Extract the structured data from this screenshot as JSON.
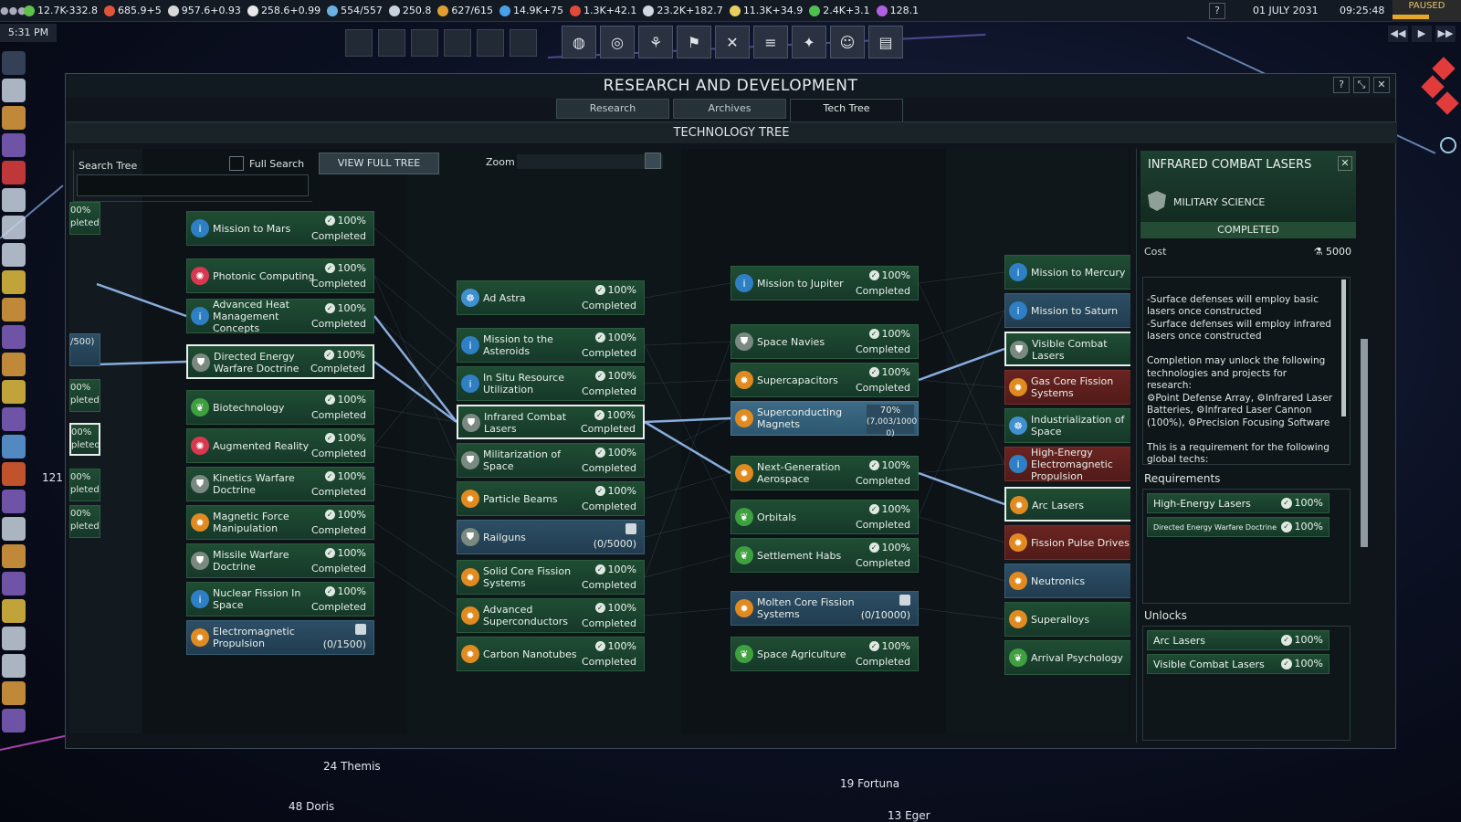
{
  "topbar": {
    "resources": [
      {
        "icon": "leaf-icon",
        "color": "#5fc24a",
        "text": "12.7K-332.8"
      },
      {
        "icon": "burst-icon",
        "color": "#e0553a",
        "text": "685.9+5"
      },
      {
        "icon": "swords-icon",
        "color": "#d8d8d8",
        "text": "957.6+0.93"
      },
      {
        "icon": "rocket-icon",
        "color": "#e8e8e8",
        "text": "258.6+0.99"
      },
      {
        "icon": "satellite-icon",
        "color": "#6ab0e0",
        "text": "554/557"
      },
      {
        "icon": "flask-icon",
        "color": "#c8d2e0",
        "text": "250.8"
      },
      {
        "icon": "coin-icon",
        "color": "#e0a030",
        "text": "627/615"
      },
      {
        "icon": "water-icon",
        "color": "#4aa0e8",
        "text": "14.9K+75"
      },
      {
        "icon": "fuel-icon",
        "color": "#e04a3a",
        "text": "1.3K+42.1"
      },
      {
        "icon": "metal-icon",
        "color": "#d0d8e0",
        "text": "23.2K+182.7"
      },
      {
        "icon": "noble-metal-icon",
        "color": "#e8d060",
        "text": "11.3K+34.9"
      },
      {
        "icon": "fissile-icon",
        "color": "#50c050",
        "text": "2.4K+3.1"
      },
      {
        "icon": "exotic-icon",
        "color": "#b060e0",
        "text": "128.1"
      }
    ],
    "help": "?",
    "date": "01 JULY 2031",
    "time": "09:25:48",
    "paused": "PAUSED",
    "clock": "5:31 PM",
    "speed_controls": [
      "◀◀",
      "▶",
      "▶▶"
    ]
  },
  "window": {
    "title": "RESEARCH AND DEVELOPMENT",
    "controls": [
      "?",
      "⤡",
      "✕"
    ],
    "tabs": [
      {
        "label": "Research",
        "active": false
      },
      {
        "label": "Archives",
        "active": false
      },
      {
        "label": "Tech Tree",
        "active": true
      }
    ],
    "subtitle": "TECHNOLOGY TREE"
  },
  "tree_controls": {
    "search_label": "Search Tree",
    "search_value": "",
    "full_search_label": "Full Search",
    "view_full_tree": "VIEW FULL TREE",
    "zoom_label": "Zoom"
  },
  "edge_nodes": [
    {
      "line1": "00%",
      "line2": "pleted"
    },
    {
      "line1": "",
      "line2": "/500)"
    },
    {
      "line1": "00%",
      "line2": "pleted"
    },
    {
      "line1": "00%",
      "line2": "pleted"
    },
    {
      "line1": "00%",
      "line2": "pleted"
    },
    {
      "line1": "00%",
      "line2": "pleted"
    }
  ],
  "col1": [
    {
      "name": "Mission to Mars",
      "pct": "100%",
      "status": "Completed",
      "icon": "info-icon",
      "style": "green"
    },
    {
      "name": "Photonic Computing",
      "pct": "100%",
      "status": "Completed",
      "icon": "virus-icon",
      "style": "green"
    },
    {
      "name": "Advanced Heat Management Concepts",
      "pct": "100%",
      "status": "Completed",
      "icon": "info-icon",
      "style": "green"
    },
    {
      "name": "Directed Energy Warfare Doctrine",
      "pct": "100%",
      "status": "Completed",
      "icon": "shield-icon",
      "style": "sel"
    },
    {
      "name": "Biotechnology",
      "pct": "100%",
      "status": "Completed",
      "icon": "sprout-icon",
      "style": "green"
    },
    {
      "name": "Augmented Reality",
      "pct": "100%",
      "status": "Completed",
      "icon": "virus-icon",
      "style": "green"
    },
    {
      "name": "Kinetics Warfare Doctrine",
      "pct": "100%",
      "status": "Completed",
      "icon": "shield-icon",
      "style": "green"
    },
    {
      "name": "Magnetic Force Manipulation",
      "pct": "100%",
      "status": "Completed",
      "icon": "gear-icon",
      "style": "green"
    },
    {
      "name": "Missile Warfare Doctrine",
      "pct": "100%",
      "status": "Completed",
      "icon": "shield-icon",
      "style": "green"
    },
    {
      "name": "Nuclear Fission In Space",
      "pct": "100%",
      "status": "Completed",
      "icon": "info-icon",
      "style": "green"
    },
    {
      "name": "Electromagnetic Propulsion",
      "pct": "",
      "status": "(0/1500)",
      "icon": "gear-icon",
      "style": "blue"
    }
  ],
  "col2": [
    {
      "name": "Ad Astra",
      "pct": "100%",
      "status": "Completed",
      "icon": "crew-icon",
      "style": "green"
    },
    {
      "name": "Mission to the Asteroids",
      "pct": "100%",
      "status": "Completed",
      "icon": "info-icon",
      "style": "green"
    },
    {
      "name": "In Situ Resource Utilization",
      "pct": "100%",
      "status": "Completed",
      "icon": "info-icon",
      "style": "green"
    },
    {
      "name": "Infrared Combat Lasers",
      "pct": "100%",
      "status": "Completed",
      "icon": "shield-icon",
      "style": "sel"
    },
    {
      "name": "Militarization of Space",
      "pct": "100%",
      "status": "Completed",
      "icon": "shield-icon",
      "style": "green"
    },
    {
      "name": "Particle Beams",
      "pct": "100%",
      "status": "Completed",
      "icon": "gear-icon",
      "style": "green"
    },
    {
      "name": "Railguns",
      "pct": "",
      "status": "(0/5000)",
      "icon": "shield-icon",
      "style": "blue"
    },
    {
      "name": "Solid Core Fission Systems",
      "pct": "100%",
      "status": "Completed",
      "icon": "gear-icon",
      "style": "green"
    },
    {
      "name": "Advanced Superconductors",
      "pct": "100%",
      "status": "Completed",
      "icon": "gear-icon",
      "style": "green"
    },
    {
      "name": "Carbon Nanotubes",
      "pct": "100%",
      "status": "Completed",
      "icon": "gear-icon",
      "style": "green"
    }
  ],
  "col3": [
    {
      "name": "Mission to Jupiter",
      "pct": "100%",
      "status": "Completed",
      "icon": "info-icon",
      "style": "green"
    },
    {
      "name": "Space Navies",
      "pct": "100%",
      "status": "Completed",
      "icon": "shield-icon",
      "style": "green"
    },
    {
      "name": "Supercapacitors",
      "pct": "100%",
      "status": "Completed",
      "icon": "gear-icon",
      "style": "green"
    },
    {
      "name": "Superconducting Magnets",
      "pct": "70%",
      "status": "(7,003/1000 0)",
      "icon": "gear-icon",
      "style": "partial"
    },
    {
      "name": "Next-Generation Aerospace",
      "pct": "100%",
      "status": "Completed",
      "icon": "gear-icon",
      "style": "green"
    },
    {
      "name": "Orbitals",
      "pct": "100%",
      "status": "Completed",
      "icon": "sprout-icon",
      "style": "green"
    },
    {
      "name": "Settlement Habs",
      "pct": "100%",
      "status": "Completed",
      "icon": "sprout-icon",
      "style": "green"
    },
    {
      "name": "Molten Core Fission Systems",
      "pct": "",
      "status": "(0/10000)",
      "icon": "gear-icon",
      "style": "blue"
    },
    {
      "name": "Space Agriculture",
      "pct": "100%",
      "status": "Completed",
      "icon": "sprout-icon",
      "style": "green"
    }
  ],
  "col4": [
    {
      "name": "Mission to Mercury",
      "suffix": "C",
      "icon": "info-icon",
      "style": "green"
    },
    {
      "name": "Mission to Saturn",
      "suffix": "(",
      "icon": "info-icon",
      "style": "blue"
    },
    {
      "name": "Visible Combat Lasers",
      "suffix": "C",
      "icon": "shield-icon",
      "style": "sel"
    },
    {
      "name": "Gas Core Fission Systems",
      "suffix": "(",
      "icon": "gear-icon",
      "style": "red"
    },
    {
      "name": "Industrialization of Space",
      "suffix": "C",
      "icon": "crew-icon",
      "style": "green"
    },
    {
      "name": "High-Energy Electromagnetic Propulsion",
      "suffix": "(",
      "icon": "info-icon",
      "style": "red"
    },
    {
      "name": "Arc Lasers",
      "suffix": "C",
      "icon": "gear-icon",
      "style": "sel"
    },
    {
      "name": "Fission Pulse Drives",
      "suffix": "(",
      "icon": "gear-icon",
      "style": "red"
    },
    {
      "name": "Neutronics",
      "suffix": "(",
      "icon": "gear-icon",
      "style": "blue"
    },
    {
      "name": "Superalloys",
      "suffix": "C",
      "icon": "gear-icon",
      "style": "green"
    },
    {
      "name": "Arrival Psychology",
      "suffix": "C",
      "icon": "sprout-icon",
      "style": "green"
    }
  ],
  "detail": {
    "title": "INFRARED COMBAT LASERS",
    "category": "MILITARY SCIENCE",
    "state": "COMPLETED",
    "cost_label": "Cost",
    "cost_value": "5000",
    "description": "-Surface defenses will employ basic lasers once constructed\n-Surface defenses will employ infrared lasers once constructed\n\nCompletion may unlock the following technologies and projects for research:\n⚙Point Defense Array, ⚙Infrared Laser Batteries, ⚙Infrared Laser Cannon (100%), ⚙Precision Focusing Software\n\nThis is a requirement for the following global techs:\nArc Lasers, Visible Combat Lasers",
    "requirements_label": "Requirements",
    "requirements": [
      {
        "name": "High-Energy Lasers",
        "pct": "100%",
        "small": false
      },
      {
        "name": "Directed Energy Warfare Doctrine",
        "pct": "100%",
        "small": true
      }
    ],
    "unlocks_label": "Unlocks",
    "unlocks": [
      {
        "name": "Arc Lasers",
        "pct": "100%"
      },
      {
        "name": "Visible Combat Lasers",
        "pct": "100%"
      }
    ]
  },
  "map": {
    "labels": [
      "24 Themis",
      "48 Doris",
      "19 Fortuna",
      "13 Eger",
      "121 H"
    ]
  },
  "colors": {
    "completed_node": "#1f4d33",
    "locked_node": "#2d4f66",
    "unavailable_node": "#6a2421",
    "partial_node": "#3d6b87",
    "link": "#8fb4e8"
  }
}
